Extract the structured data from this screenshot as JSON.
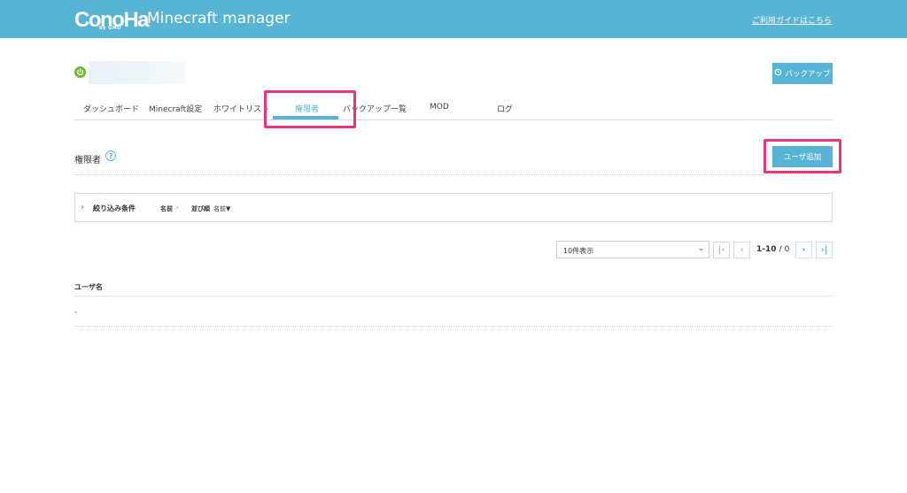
{
  "header": {
    "logo_text": "ConoHa",
    "logo_sub": "by GMO",
    "title": "Minecraft manager",
    "guide_link": "ご利用ガイドはこちら"
  },
  "server": {
    "status": "online",
    "backup_label": "バックアップ"
  },
  "tabs": [
    {
      "label": "ダッシュボード"
    },
    {
      "label": "Minecraft設定"
    },
    {
      "label": "ホワイトリスト"
    },
    {
      "label": "権限者",
      "active": true
    },
    {
      "label": "バックアップ一覧"
    },
    {
      "label": "MOD"
    },
    {
      "label": "ログ"
    }
  ],
  "section": {
    "title": "権限者",
    "help": "?",
    "add_user_label": "ユーザ追加"
  },
  "filter": {
    "label": "絞り込み条件",
    "name_key": "名前",
    "name_value": "-",
    "sort_key": "並び順",
    "sort_value": "名前▼"
  },
  "pagination": {
    "per_page": "10件表示",
    "range": "1-10",
    "total": "/ 0"
  },
  "table": {
    "columns": [
      "ユーザ名"
    ],
    "rows": [
      [
        "-"
      ]
    ]
  },
  "colors": {
    "accent": "#57b4d4",
    "highlight": "#e8347b",
    "status_online": "#6cbb2a"
  }
}
